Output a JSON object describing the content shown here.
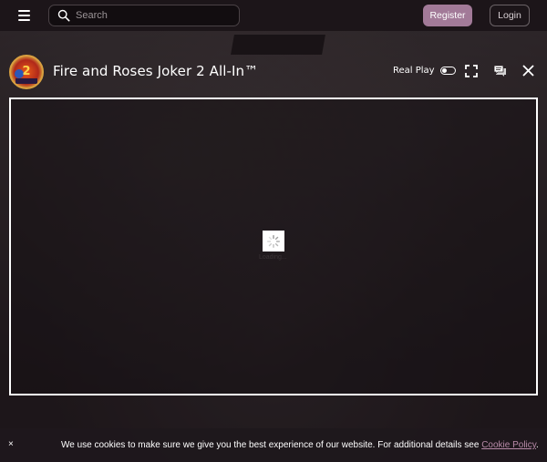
{
  "header": {
    "menu_icon": "hamburger-icon",
    "search": {
      "placeholder": "Search",
      "value": "",
      "icon": "search-icon"
    },
    "register_label": "Register",
    "login_label": "Login",
    "colors": {
      "register_bg": "#a27a98",
      "topbar_bg": "#1c1519"
    }
  },
  "game": {
    "title": "Fire and Roses Joker 2 All-In™",
    "logo_number": "2",
    "real_play_label": "Real Play",
    "real_play_on": false,
    "icons": [
      "fullscreen-icon",
      "chat-icon",
      "close-icon"
    ],
    "loading_text": "Loading..."
  },
  "cookie": {
    "close_label": "×",
    "text": "We use cookies to make sure we give you the best experience of our website. For additional details see ",
    "link_label": "Cookie Policy",
    "suffix": ".",
    "link_color": "#b88aa8"
  }
}
